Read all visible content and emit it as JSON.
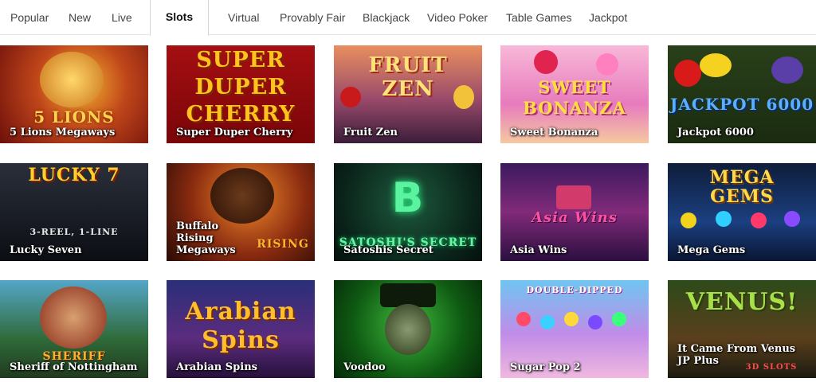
{
  "tabs": [
    {
      "label": "Popular"
    },
    {
      "label": "New"
    },
    {
      "label": "Live"
    },
    {
      "label": "Slots"
    },
    {
      "label": "Virtual"
    },
    {
      "label": "Provably Fair"
    },
    {
      "label": "Blackjack"
    },
    {
      "label": "Video Poker"
    },
    {
      "label": "Table Games"
    },
    {
      "label": "Jackpot"
    }
  ],
  "active_tab": "Slots",
  "games": [
    {
      "title": "5 Lions Megaways",
      "art": "5 LIONS"
    },
    {
      "title": "Super Duper Cherry",
      "art": "SUPER DUPER CHERRY"
    },
    {
      "title": "Fruit Zen",
      "art": "FRUIT ZEN"
    },
    {
      "title": "Sweet Bonanza",
      "art": "SWEET BONANZA"
    },
    {
      "title": "Jackpot 6000",
      "art": "JACKPOT 6000"
    },
    {
      "title": "Lucky Seven",
      "art": "LUCKY 7",
      "subart": "3-REEL, 1-LINE"
    },
    {
      "title": "Buffalo Rising Megaways",
      "art": "RISING"
    },
    {
      "title": "Satoshis Secret",
      "art": "SATOSHI'S SECRET"
    },
    {
      "title": "Asia Wins",
      "art": "Asia Wins"
    },
    {
      "title": "Mega Gems",
      "art": "MEGA GEMS"
    },
    {
      "title": "Sheriff of Nottingham",
      "art": "SHERIFF"
    },
    {
      "title": "Arabian Spins",
      "art": "Arabian Spins"
    },
    {
      "title": "Voodoo",
      "art": ""
    },
    {
      "title": "Sugar Pop 2",
      "art": "DOUBLE-DIPPED"
    },
    {
      "title": "It Came From Venus JP Plus",
      "art": "VENUS!",
      "subart": "3D SLOTS"
    }
  ]
}
